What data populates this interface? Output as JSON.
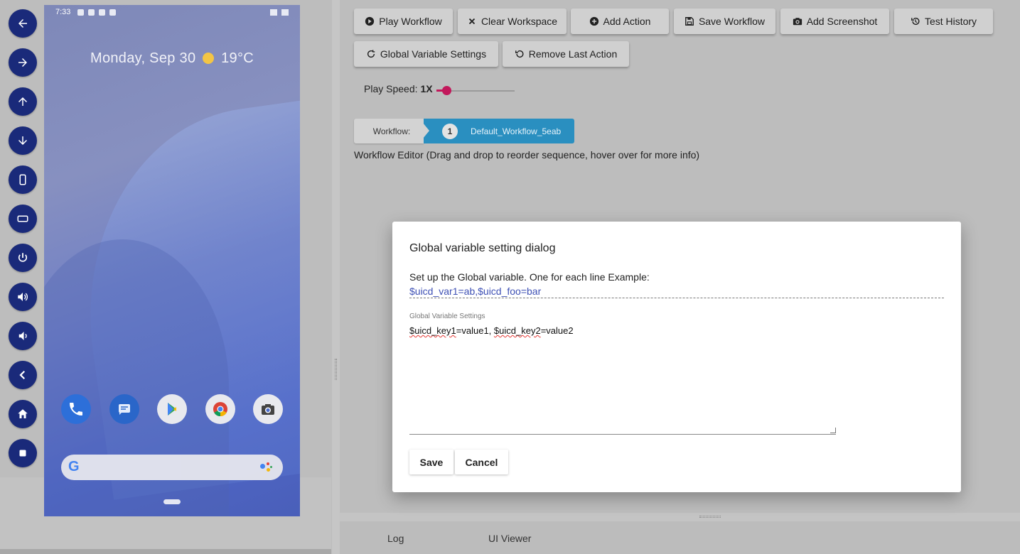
{
  "device": {
    "status_time": "7:33",
    "date_weather": "Monday, Sep 30",
    "temperature": "19°C",
    "dock_apps": [
      "phone-app-icon",
      "messages-app-icon",
      "play-store-icon",
      "chrome-icon",
      "camera-app-icon"
    ],
    "search_letter": "G"
  },
  "device_controls": [
    "back-icon",
    "forward-icon",
    "up-arrow-icon",
    "down-arrow-icon",
    "portrait-rotate-icon",
    "landscape-rotate-icon",
    "power-icon",
    "volume-up-icon",
    "volume-down-icon",
    "nav-back-icon",
    "home-icon",
    "overview-icon"
  ],
  "toolbar": {
    "play_workflow": "Play Workflow",
    "clear_workspace": "Clear Workspace",
    "add_action": "Add Action",
    "save_workflow": "Save Workflow",
    "add_screenshot": "Add Screenshot",
    "test_history": "Test History",
    "global_variable_settings": "Global Variable Settings",
    "remove_last_action": "Remove Last Action"
  },
  "play_speed": {
    "label": "Play Speed:",
    "value": "1X",
    "slider_fraction": 0.1
  },
  "workflow": {
    "label": "Workflow:",
    "index": "1",
    "name": "Default_Workflow_5eab"
  },
  "editor_hint": "Workflow Editor (Drag and drop to reorder sequence, hover over for more info)",
  "dialog": {
    "title": "Global variable setting dialog",
    "description": "Set up the Global variable. One for each line Example:",
    "example": "$uicd_var1=ab,$uicd_foo=bar",
    "field_label": "Global Variable Settings",
    "field_value_part1": "$uicd_key1",
    "field_value_part2": "=value1, ",
    "field_value_part3": "$uicd_key2",
    "field_value_part4": "=value2",
    "save": "Save",
    "cancel": "Cancel"
  },
  "bottom_tabs": {
    "log": "Log",
    "ui_viewer": "UI Viewer"
  },
  "colors": {
    "control_button": "#1a2a7a",
    "workflow_chip": "#2a8fc0",
    "slider_accent": "#c2185b",
    "example_text": "#3f51b5"
  }
}
